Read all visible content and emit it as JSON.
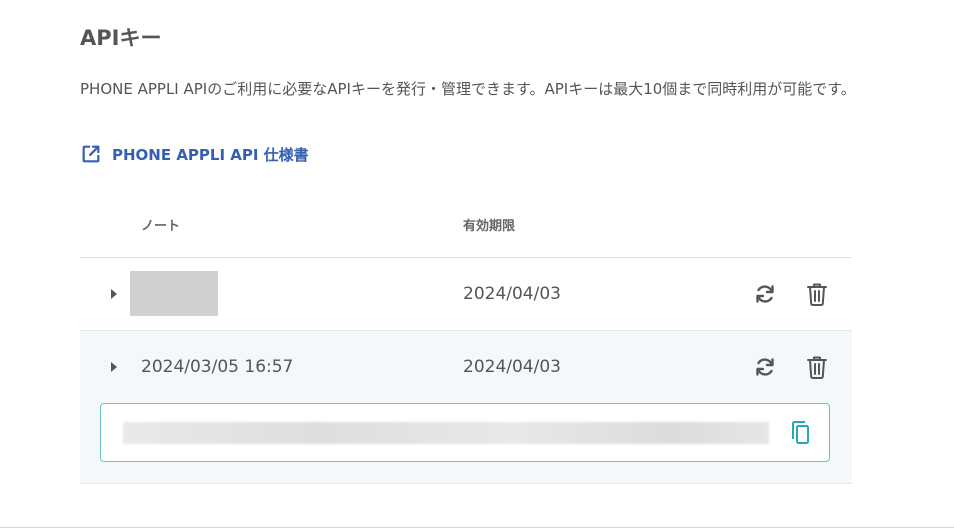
{
  "header": {
    "title": "APIキー",
    "description": "PHONE APPLI APIのご利用に必要なAPIキーを発行・管理できます。APIキーは最大10個まで同時利用が可能です。",
    "spec_link_label": "PHONE APPLI API 仕様書"
  },
  "table": {
    "columns": {
      "note": "ノート",
      "expiry": "有効期限"
    },
    "rows": [
      {
        "note": "",
        "expiry": "2024/04/03",
        "expanded": false
      },
      {
        "note": "2024/03/05 16:57",
        "expiry": "2024/04/03",
        "expanded": true
      }
    ]
  },
  "icons": {
    "external_link": "external-link-icon",
    "refresh": "refresh-icon",
    "delete": "trash-icon",
    "copy": "copy-icon",
    "expand": "caret-right-icon"
  },
  "colors": {
    "link": "#3560b0",
    "key_box_border": "#6cc4cc",
    "expanded_row_bg": "#f3f8fb",
    "copy_icon": "#2aa7b5"
  }
}
